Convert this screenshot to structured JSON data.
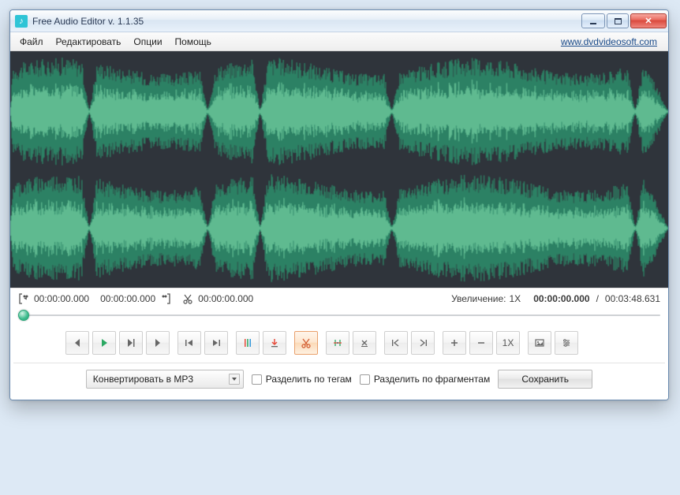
{
  "window": {
    "title": "Free Audio Editor v. 1.1.35"
  },
  "menu": {
    "file": "Файл",
    "edit": "Редактировать",
    "options": "Опции",
    "help": "Помощь",
    "link": "www.dvdvideosoft.com"
  },
  "times": {
    "sel_start": "00:00:00.000",
    "sel_end": "00:00:00.000",
    "cut_pos": "00:00:00.000",
    "zoom_label": "Увеличение:",
    "zoom_value": "1X",
    "position": "00:00:00.000",
    "separator": "/",
    "total": "00:03:48.631"
  },
  "zoom_btn_text": "1X",
  "bottom": {
    "convert": "Конвертировать в MP3",
    "split_tags": "Разделить по тегам",
    "split_fragments": "Разделить по фрагментам",
    "save": "Сохранить"
  },
  "colors": {
    "waveform_bg": "#2f343b",
    "waveform_outer": "#2c9b73",
    "waveform_inner": "#7fd6a9",
    "accent": "#3dbb8d"
  }
}
